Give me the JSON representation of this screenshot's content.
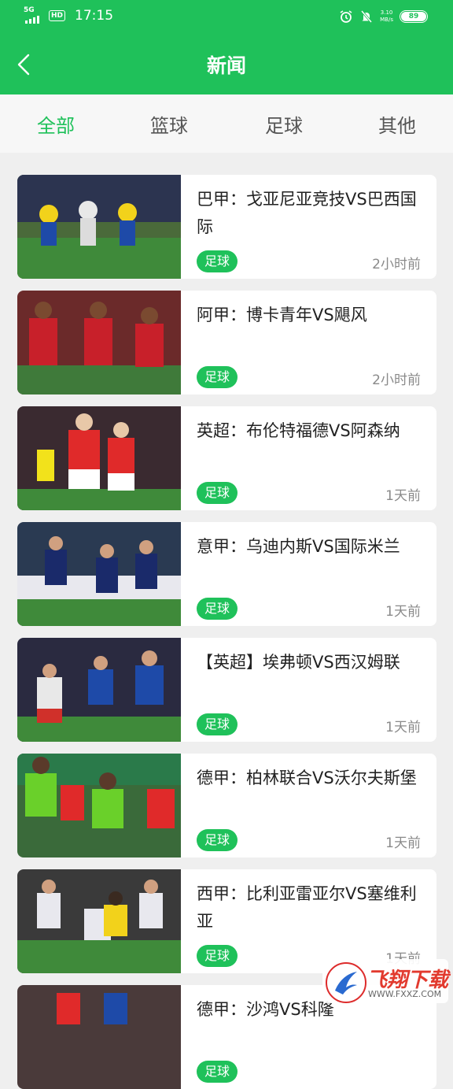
{
  "status_bar": {
    "network": "5G",
    "hd": "HD",
    "time": "17:15",
    "speed": "3.10",
    "speed_unit": "MB/s",
    "battery": "89"
  },
  "nav": {
    "title": "新闻"
  },
  "tabs": [
    {
      "label": "全部",
      "active": true
    },
    {
      "label": "篮球",
      "active": false
    },
    {
      "label": "足球",
      "active": false
    },
    {
      "label": "其他",
      "active": false
    }
  ],
  "articles": [
    {
      "title": "巴甲：戈亚尼亚竞技VS巴西国际",
      "tag": "足球",
      "time": "2小时前"
    },
    {
      "title": "阿甲：博卡青年VS飓风",
      "tag": "足球",
      "time": "2小时前"
    },
    {
      "title": "英超：布伦特福德VS阿森纳",
      "tag": "足球",
      "time": "1天前"
    },
    {
      "title": "意甲：乌迪内斯VS国际米兰",
      "tag": "足球",
      "time": "1天前"
    },
    {
      "title": "【英超】埃弗顿VS西汉姆联",
      "tag": "足球",
      "time": "1天前"
    },
    {
      "title": "德甲：柏林联合VS沃尔夫斯堡",
      "tag": "足球",
      "time": "1天前"
    },
    {
      "title": "西甲：比利亚雷亚尔VS塞维利亚",
      "tag": "足球",
      "time": "1天前"
    },
    {
      "title": "德甲：沙鸿VS科隆",
      "tag": "足球",
      "time": ""
    }
  ],
  "watermark": {
    "text": "飞翔下载",
    "url": "WWW.FXXZ.COM"
  },
  "colors": {
    "accent": "#1fc15a",
    "background": "#efefef"
  }
}
